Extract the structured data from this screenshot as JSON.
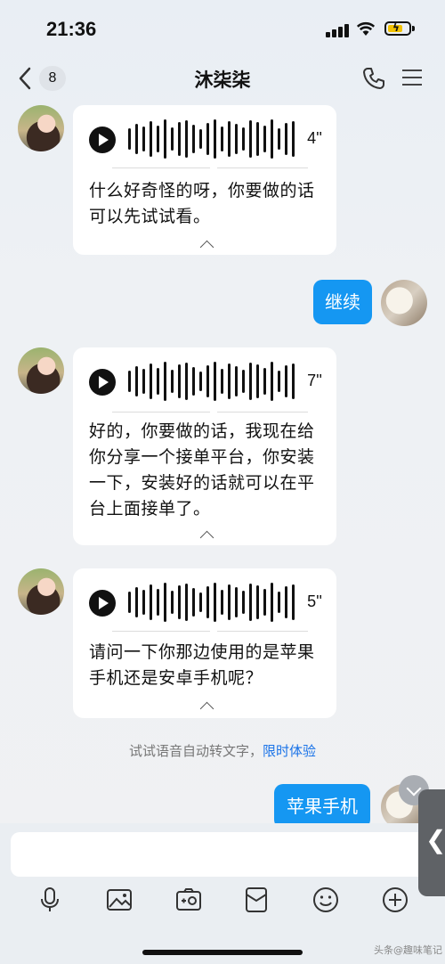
{
  "status": {
    "time": "21:36"
  },
  "nav": {
    "unread_count": "8",
    "contact_name": "沐柒柒"
  },
  "messages": [
    {
      "duration": "4''",
      "text": "什么好奇怪的呀，你要做的话可以先试试看。"
    },
    {
      "text": "继续"
    },
    {
      "duration": "7''",
      "text": "好的，你要做的话，我现在给你分享一个接单平台，你安装一下，安装好的话就可以在平台上面接单了。"
    },
    {
      "duration": "5''",
      "text": "请问一下你那边使用的是苹果手机还是安卓手机呢？"
    },
    {
      "text": "苹果手机"
    }
  ],
  "tip": {
    "text": "试试语音自动转文字，",
    "link": "限时体验"
  },
  "input": {
    "placeholder": ""
  },
  "toolbar": {
    "icons": [
      "microphone-icon",
      "image-icon",
      "camera-icon",
      "red-packet-icon",
      "emoji-icon",
      "plus-icon"
    ]
  },
  "watermark": "头条@趣味笔记",
  "colors": {
    "my_bubble": "#1597f2",
    "link": "#1a73e8"
  }
}
